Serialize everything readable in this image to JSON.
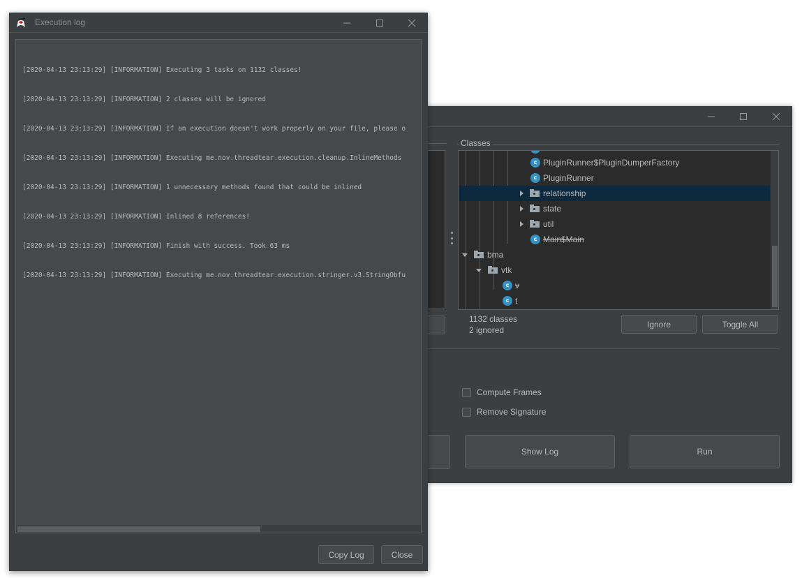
{
  "main_window": {
    "title_controls": {
      "minimize": "minimize-icon",
      "maximize": "maximize-icon",
      "close": "close-icon"
    },
    "classes_group": {
      "title": "Classes",
      "tree": [
        {
          "label": "PluginRunner$PluginDumperFactory",
          "type": "class",
          "depth": 5,
          "ignored": false
        },
        {
          "label": "PluginRunner",
          "type": "class",
          "depth": 5,
          "ignored": false
        },
        {
          "label": "relationship",
          "type": "package",
          "depth": 4,
          "expanded": false,
          "selected": true
        },
        {
          "label": "state",
          "type": "package",
          "depth": 4,
          "expanded": false
        },
        {
          "label": "util",
          "type": "package",
          "depth": 4,
          "expanded": false
        },
        {
          "label": "Main$Main",
          "type": "class",
          "depth": 5,
          "ignored": true
        },
        {
          "label": "bma",
          "type": "package",
          "depth": 0,
          "expanded": true
        },
        {
          "label": "vtk",
          "type": "package",
          "depth": 1,
          "expanded": true
        },
        {
          "label": "v",
          "type": "class",
          "depth": 3,
          "ignored": true
        },
        {
          "label": "t",
          "type": "class",
          "depth": 3,
          "ignored": false
        }
      ],
      "class_icon_letter": "c",
      "class_count": "1132 classes",
      "ignored_count": "2 ignored",
      "ignore_button": "Ignore",
      "toggle_all_button": "Toggle All"
    },
    "options": {
      "compute_frames": {
        "label": "Compute Frames",
        "checked": false
      },
      "remove_signature": {
        "label": "Remove Signature",
        "checked": false
      }
    },
    "show_log_button": "Show Log",
    "run_button": "Run"
  },
  "log_window": {
    "title": "Execution log",
    "lines": [
      "[2020-04-13 23:13:29] [INFORMATION] Executing 3 tasks on 1132 classes!",
      "[2020-04-13 23:13:29] [INFORMATION] 2 classes will be ignored",
      "[2020-04-13 23:13:29] [INFORMATION] If an execution doesn't work properly on your file, please o",
      "[2020-04-13 23:13:29] [INFORMATION] Executing me.nov.threadtear.execution.cleanup.InlineMethods",
      "[2020-04-13 23:13:29] [INFORMATION] 1 unnecessary methods found that could be inlined",
      "[2020-04-13 23:13:29] [INFORMATION] Inlined 8 references!",
      "[2020-04-13 23:13:29] [INFORMATION] Finish with success. Took 63 ms",
      "[2020-04-13 23:13:29] [INFORMATION] Executing me.nov.threadtear.execution.stringer.v3.StringObfu"
    ],
    "copy_log_button": "Copy Log",
    "close_button": "Close"
  },
  "colors": {
    "window_bg": "#3c3f41",
    "tree_bg": "#2b2b2b",
    "selection": "#0d293e",
    "class_icon": "#3592c4",
    "text": "#bbbbbb"
  }
}
